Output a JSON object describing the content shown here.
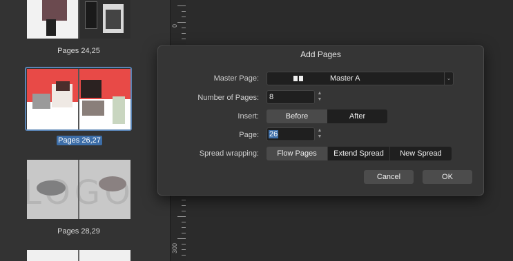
{
  "pages_panel": {
    "spreads": [
      {
        "caption": "Pages 24,25",
        "selected": false
      },
      {
        "caption": "Pages 26,27",
        "selected": true
      },
      {
        "caption": "Pages 28,29",
        "selected": false
      }
    ],
    "logo_text": "LOGO"
  },
  "ruler": {
    "labels": [
      "0",
      "300"
    ]
  },
  "dialog": {
    "title": "Add Pages",
    "master_page": {
      "label": "Master Page:",
      "value": "Master A"
    },
    "number_of_pages": {
      "label": "Number of Pages:",
      "value": "8"
    },
    "insert": {
      "label": "Insert:",
      "options": [
        "Before",
        "After"
      ],
      "selected": "Before"
    },
    "page": {
      "label": "Page:",
      "value": "26"
    },
    "spread_wrapping": {
      "label": "Spread wrapping:",
      "options": [
        "Flow Pages",
        "Extend Spread",
        "New Spread"
      ],
      "selected": "Flow Pages"
    },
    "cancel_label": "Cancel",
    "ok_label": "OK"
  },
  "colors": {
    "accent": "#3d6ea8",
    "panel": "#333333",
    "dialog": "#353535",
    "field": "#1f1f1f"
  }
}
